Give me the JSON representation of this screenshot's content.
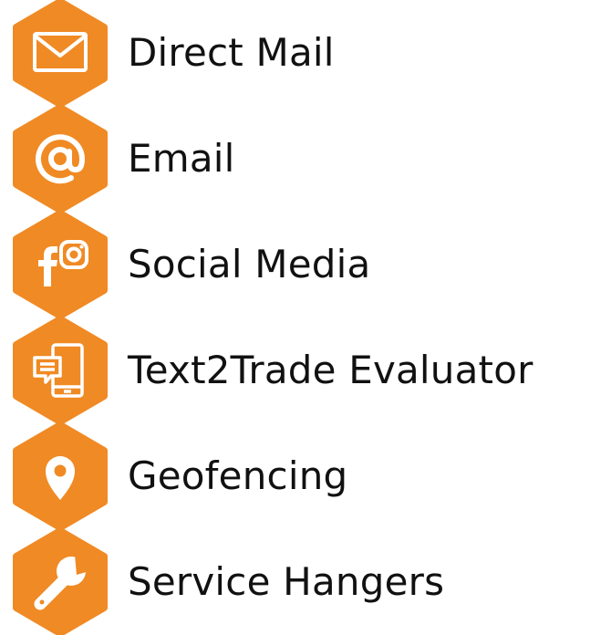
{
  "accent_color": "#F08A24",
  "icon_color": "#FFFFFF",
  "text_color": "#111111",
  "items": [
    {
      "label": "Direct Mail",
      "icon": "envelope-icon"
    },
    {
      "label": "Email",
      "icon": "at-sign-icon"
    },
    {
      "label": "Social Media",
      "icon": "facebook-instagram-icon"
    },
    {
      "label": "Text2Trade Evaluator",
      "icon": "phone-message-icon"
    },
    {
      "label": "Geofencing",
      "icon": "location-pin-icon"
    },
    {
      "label": "Service Hangers",
      "icon": "wrench-icon"
    }
  ]
}
